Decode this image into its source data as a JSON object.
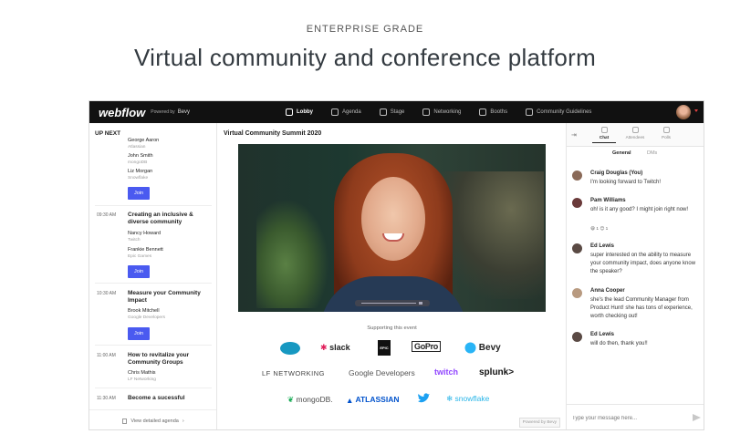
{
  "hero": {
    "eyebrow": "ENTERPRISE GRADE",
    "title": "Virtual community and conference platform"
  },
  "topbar": {
    "logo": "webflow",
    "powered_by": "Powered by",
    "powered_brand": "Bevy",
    "nav": [
      {
        "label": "Lobby",
        "icon": "home-icon",
        "active": true
      },
      {
        "label": "Agenda",
        "icon": "calendar-icon",
        "active": false
      },
      {
        "label": "Stage",
        "icon": "stage-icon",
        "active": false
      },
      {
        "label": "Networking",
        "icon": "networking-icon",
        "active": false
      },
      {
        "label": "Booths",
        "icon": "booth-icon",
        "active": false
      },
      {
        "label": "Community Guidelines",
        "icon": "guidelines-icon",
        "active": false
      }
    ]
  },
  "upnext": {
    "title": "UP NEXT",
    "sessions": [
      {
        "time": "",
        "title": "",
        "speakers": [
          {
            "name": "George Aaron",
            "company": "Atlassian"
          },
          {
            "name": "John Smith",
            "company": "mongoDB"
          },
          {
            "name": "Liz Morgan",
            "company": "Snowflake"
          }
        ],
        "join": "Join"
      },
      {
        "time": "09:30 AM",
        "title": "Creating an inclusive & diverse community",
        "speakers": [
          {
            "name": "Nancy Howard",
            "company": "Twitch"
          },
          {
            "name": "Frankie Bennett",
            "company": "Epic Games"
          }
        ],
        "join": "Join"
      },
      {
        "time": "10:30 AM",
        "title": "Measure your Community Impact",
        "speakers": [
          {
            "name": "Brook Mitchell",
            "company": "Google Developers"
          }
        ],
        "join": "Join"
      },
      {
        "time": "11:00 AM",
        "title": "How to revitalize your Community Groups",
        "speakers": [
          {
            "name": "Chris Mathis",
            "company": "LF Networking"
          }
        ],
        "join": ""
      },
      {
        "time": "11:30 AM",
        "title": "Become a sucessful",
        "speakers": [],
        "join": ""
      }
    ],
    "view_agenda": "View detailed agenda"
  },
  "center": {
    "event_title": "Virtual Community Summit 2020",
    "supporting": "Supporting this event",
    "sponsors_row1": [
      "salesforce",
      "slack",
      "EPIC",
      "GoPro",
      "Bevy"
    ],
    "sponsors_row2": [
      "LF NETWORKING",
      "Google Developers",
      "twitch",
      "splunk>"
    ],
    "sponsors_row3": [
      "mongoDB.",
      "ATLASSIAN",
      "twitter",
      "snowflake"
    ],
    "powered": "Powered by Bevy"
  },
  "chat": {
    "tabs": [
      {
        "label": "Chat",
        "icon": "chat-icon",
        "active": true
      },
      {
        "label": "Attendees",
        "icon": "attendees-icon",
        "active": false
      },
      {
        "label": "Polls",
        "icon": "polls-icon",
        "active": false
      }
    ],
    "subtabs": [
      {
        "label": "General",
        "active": true
      },
      {
        "label": "DMs",
        "active": false
      }
    ],
    "messages": [
      {
        "name": "Craig Douglas (You)",
        "text": "I'm looking forward to Twitch!",
        "avatar_color": "#8a6a58"
      },
      {
        "name": "Pam Williams",
        "text": "oh! is it any good? I might join right now!",
        "avatar_color": "#6a3a3a",
        "reactions": "😄 1  😊 1"
      },
      {
        "name": "Ed Lewis",
        "text": "super interested on the ability to measure your community impact, does anyone know the speaker?",
        "avatar_color": "#5a4a44"
      },
      {
        "name": "Anna Cooper",
        "text": "she's the lead Community Manager from Product Hunt! she has tons of experience, worth checking out!",
        "avatar_color": "#b89a80"
      },
      {
        "name": "Ed Lewis",
        "text": "will do then, thank you!!",
        "avatar_color": "#5a4a44"
      }
    ],
    "input_placeholder": "Type your message here..."
  },
  "colors": {
    "accent": "#4a5af0",
    "topbar": "#111111"
  }
}
